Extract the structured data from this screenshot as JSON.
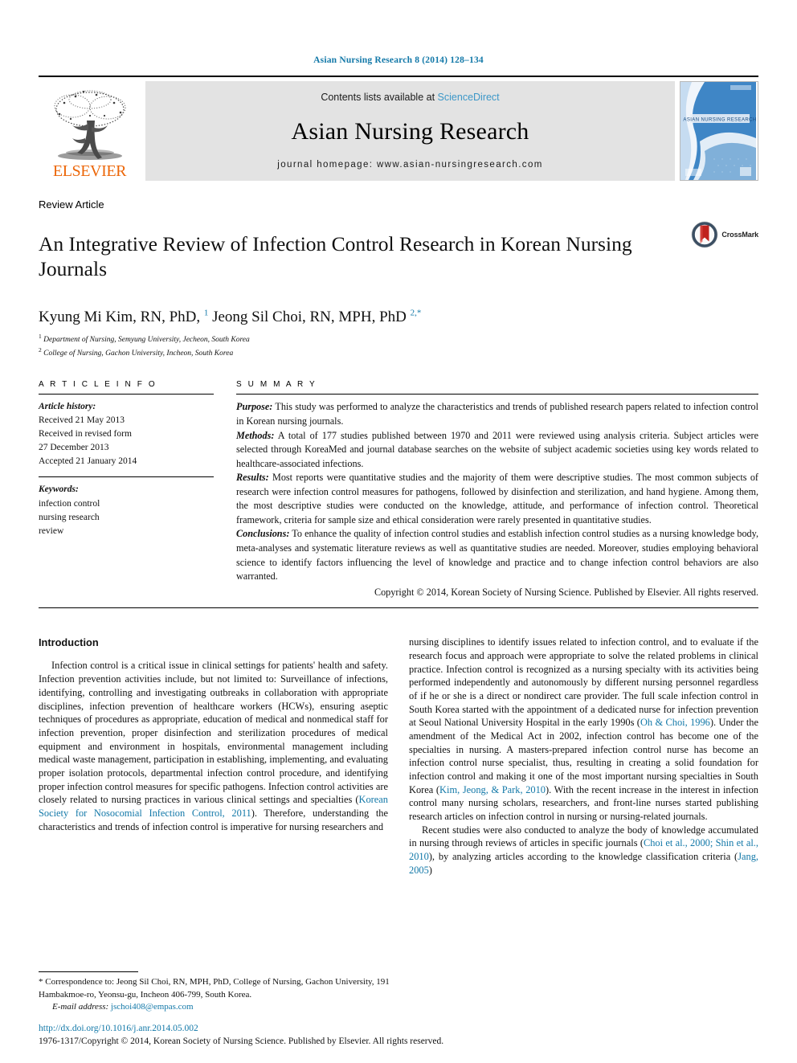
{
  "running_head": "Asian Nursing Research 8 (2014) 128–134",
  "banner": {
    "publisher_name": "ELSEVIER",
    "contents_prefix": "Contents lists available at",
    "sciencedirect": "ScienceDirect",
    "journal_name": "Asian Nursing Research",
    "homepage": "journal homepage: www.asian-nursingresearch.com",
    "cover_title": "ASIAN NURSING RESEARCH"
  },
  "article": {
    "type": "Review Article",
    "title": "An Integrative Review of Infection Control Research in Korean Nursing Journals",
    "crossmark_label": "CrossMark",
    "authors_html": "Kyung Mi Kim, RN, PhD, <sup>1</sup> Jeong Sil Choi, RN, MPH, PhD <sup>2,*</sup>",
    "affiliation_1": "Department of Nursing, Semyung University, Jecheon, South Korea",
    "affiliation_2": "College of Nursing, Gachon University, Incheon, South Korea"
  },
  "info": {
    "heading": "A R T I C L E   I N F O",
    "history_label": "Article history:",
    "history_lines": [
      "Received 21 May 2013",
      "Received in revised form",
      "27 December 2013",
      "Accepted 21 January 2014"
    ],
    "keywords_label": "Keywords:",
    "keywords": [
      "infection control",
      "nursing research",
      "review"
    ]
  },
  "summary": {
    "heading": "S U M M A R Y",
    "purpose_label": "Purpose:",
    "purpose_text": " This study was performed to analyze the characteristics and trends of published research papers related to infection control in Korean nursing journals.",
    "methods_label": "Methods:",
    "methods_text": " A total of 177 studies published between 1970 and 2011 were reviewed using analysis criteria. Subject articles were selected through KoreaMed and journal database searches on the website of subject academic societies using key words related to healthcare-associated infections.",
    "results_label": "Results:",
    "results_text": " Most reports were quantitative studies and the majority of them were descriptive studies. The most common subjects of research were infection control measures for pathogens, followed by disinfection and sterilization, and hand hygiene. Among them, the most descriptive studies were conducted on the knowledge, attitude, and performance of infection control. Theoretical framework, criteria for sample size and ethical consideration were rarely presented in quantitative studies.",
    "conclusions_label": "Conclusions:",
    "conclusions_text": " To enhance the quality of infection control studies and establish infection control studies as a nursing knowledge body, meta-analyses and systematic literature reviews as well as quantitative studies are needed. Moreover, studies employing behavioral science to identify factors influencing the level of knowledge and practice and to change infection control behaviors are also warranted.",
    "copyright": "Copyright © 2014, Korean Society of Nursing Science. Published by Elsevier. All rights reserved."
  },
  "body": {
    "intro_heading": "Introduction",
    "left_para_1_html": "Infection control is a critical issue in clinical settings for patients' health and safety. Infection prevention activities include, but not limited to: Surveillance of infections, identifying, controlling and investigating outbreaks in collaboration with appropriate disciplines, infection prevention of healthcare workers (HCWs), ensuring aseptic techniques of procedures as appropriate, education of medical and nonmedical staff for infection prevention, proper disinfection and sterilization procedures of medical equipment and environment in hospitals, environmental management including medical waste management, participation in establishing, implementing, and evaluating proper isolation protocols, departmental infection control procedure, and identifying proper infection control measures for specific pathogens. Infection control activities are closely related to nursing practices in various clinical settings and specialties (<span class=\"ref\">Korean Society for Nosocomial Infection Control, 2011</span>). Therefore, understanding the characteristics and trends of infection control is imperative for nursing researchers and",
    "right_para_1_html": "nursing disciplines to identify issues related to infection control, and to evaluate if the research focus and approach were appropriate to solve the related problems in clinical practice. Infection control is recognized as a nursing specialty with its activities being performed independently and autonomously by different nursing personnel regardless of if he or she is a direct or nondirect care provider. The full scale infection control in South Korea started with the appointment of a dedicated nurse for infection prevention at Seoul National University Hospital in the early 1990s (<span class=\"ref\">Oh &amp; Choi, 1996</span>). Under the amendment of the Medical Act in 2002, infection control has become one of the specialties in nursing. A masters-prepared infection control nurse has become an infection control nurse specialist, thus, resulting in creating a solid foundation for infection control and making it one of the most important nursing specialties in South Korea (<span class=\"ref\">Kim, Jeong, &amp; Park, 2010</span>). With the recent increase in the interest in infection control many nursing scholars, researchers, and front-line nurses started publishing research articles on infection control in nursing or nursing-related journals.",
    "right_para_2_html": "Recent studies were also conducted to analyze the body of knowledge accumulated in nursing through reviews of articles in specific journals (<span class=\"ref\">Choi et al., 2000; Shin et al., 2010</span>), by analyzing articles according to the knowledge classification criteria (<span class=\"ref\">Jang, 2005</span>)"
  },
  "footnotes": {
    "correspondence_html": "* Correspondence to: Jeong Sil Choi, RN, MPH, PhD, College of Nursing, Gachon University, 191 Hambakmoe-ro, Yeonsu-gu, Incheon 406-799, South Korea.",
    "email_label": "E-mail address:",
    "email": "jschoi408@empas.com",
    "doi": "http://dx.doi.org/10.1016/j.anr.2014.05.002",
    "issn_line": "1976-1317/Copyright © 2014, Korean Society of Nursing Science. Published by Elsevier. All rights reserved."
  },
  "colors": {
    "link_blue": "#1278a8",
    "sciencedirect_blue": "#3c97c8",
    "elsevier_orange": "#ec6608",
    "banner_gray": "#e3e3e3"
  }
}
